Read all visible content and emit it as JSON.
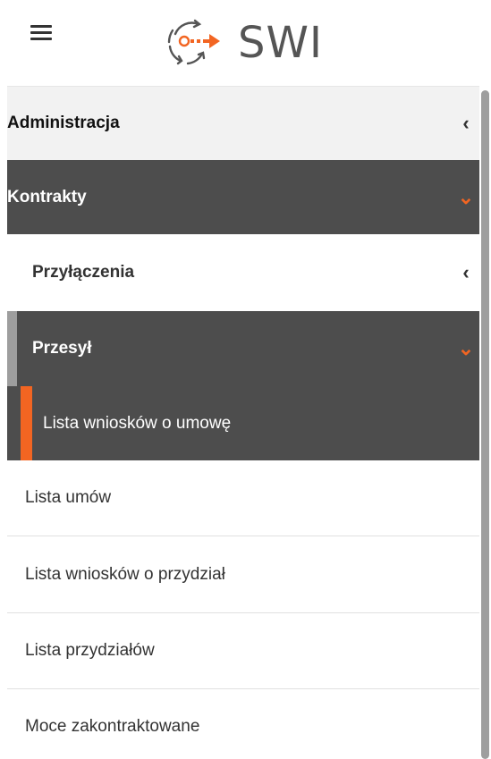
{
  "header": {
    "menu_icon": "hamburger-icon",
    "logo_text": "SWI",
    "logo_icon": "swi-cycle-arrow-icon",
    "brand_color": "#f26522"
  },
  "menu": {
    "items": [
      {
        "label": "Administracja",
        "chevron": "‹",
        "state": "collapsed"
      },
      {
        "label": "Kontrakty",
        "chevron": "⌄",
        "state": "expanded"
      },
      {
        "label": "Przyłączenia",
        "chevron": "‹",
        "state": "collapsed"
      },
      {
        "label": "Przesył",
        "chevron": "⌄",
        "state": "expanded"
      },
      {
        "label": "Lista wniosków o umowę",
        "state": "active"
      },
      {
        "label": "Lista umów"
      },
      {
        "label": "Lista wniosków o przydział"
      },
      {
        "label": "Lista przydziałów"
      },
      {
        "label": "Moce zakontraktowane"
      }
    ]
  },
  "colors": {
    "accent": "#f26522",
    "dark_bg": "#4d4d4d",
    "light_bg": "#f2f2f2"
  }
}
